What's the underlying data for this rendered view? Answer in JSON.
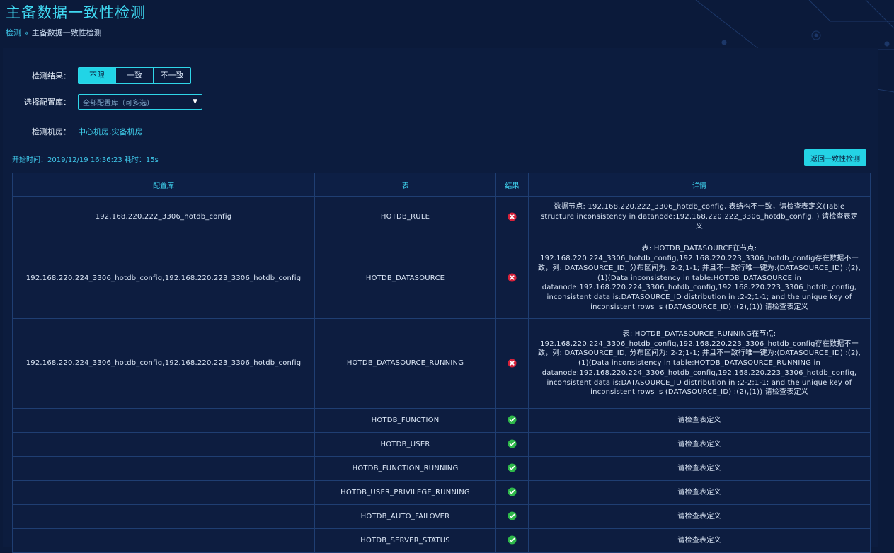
{
  "page": {
    "title": "主备数据一致性检测",
    "breadcrumb": {
      "parent": "检测",
      "separator": "»",
      "current": "主备数据一致性检测"
    }
  },
  "filters": {
    "result_label": "检测结果：",
    "result_options": [
      "不限",
      "一致",
      "不一致"
    ],
    "result_selected": "不限",
    "config_label": "选择配置库：",
    "config_placeholder": "全部配置库（可多选）",
    "room_label": "检测机房：",
    "room_value": "中心机房,灾备机房"
  },
  "run_info": "开始时间：2019/12/19 16:36:23 耗时：15s",
  "back_button": "返回一致性检测",
  "colors": {
    "accent": "#24d3e5",
    "background": "#0b1a3a",
    "ok": "#2eb84a",
    "error": "#d6213a"
  },
  "table": {
    "headers": [
      "配置库",
      "表",
      "结果",
      "详情"
    ],
    "rows": [
      {
        "config": "192.168.220.222_3306_hotdb_config",
        "table": "HOTDB_RULE",
        "result": "error",
        "detail": "数据节点: 192.168.220.222_3306_hotdb_config, 表结构不一致，请检查表定义(Table structure inconsistency in datanode:192.168.220.222_3306_hotdb_config, ) 请检查表定义"
      },
      {
        "config": "192.168.220.224_3306_hotdb_config,192.168.220.223_3306_hotdb_config",
        "table": "HOTDB_DATASOURCE",
        "result": "error",
        "detail": "表: HOTDB_DATASOURCE在节点: 192.168.220.224_3306_hotdb_config,192.168.220.223_3306_hotdb_config存在数据不一致，列: DATASOURCE_ID, 分布区间为: 2-2;1-1; 并且不一致行唯一键为:(DATASOURCE_ID) :(2),(1)(Data inconsistency in table:HOTDB_DATASOURCE in datanode:192.168.220.224_3306_hotdb_config,192.168.220.223_3306_hotdb_config, inconsistent data is:DATASOURCE_ID distribution in :2-2;1-1; and the unique key of inconsistent rows is (DATASOURCE_ID) :(2),(1)) 请检查表定义"
      },
      {
        "config": "192.168.220.224_3306_hotdb_config,192.168.220.223_3306_hotdb_config",
        "table": "HOTDB_DATASOURCE_RUNNING",
        "result": "error",
        "detail": "表: HOTDB_DATASOURCE_RUNNING在节点: 192.168.220.224_3306_hotdb_config,192.168.220.223_3306_hotdb_config存在数据不一致，列: DATASOURCE_ID, 分布区间为: 2-2;1-1; 并且不一致行唯一键为:(DATASOURCE_ID) :(2),(1)(Data inconsistency in table:HOTDB_DATASOURCE_RUNNING in datanode:192.168.220.224_3306_hotdb_config,192.168.220.223_3306_hotdb_config, inconsistent data is:DATASOURCE_ID distribution in :2-2;1-1; and the unique key of inconsistent rows is (DATASOURCE_ID) :(2),(1)) 请检查表定义"
      },
      {
        "config": "",
        "table": "HOTDB_FUNCTION",
        "result": "ok",
        "detail": "请检查表定义"
      },
      {
        "config": "",
        "table": "HOTDB_USER",
        "result": "ok",
        "detail": "请检查表定义"
      },
      {
        "config": "",
        "table": "HOTDB_FUNCTION_RUNNING",
        "result": "ok",
        "detail": "请检查表定义"
      },
      {
        "config": "",
        "table": "HOTDB_USER_PRIVILEGE_RUNNING",
        "result": "ok",
        "detail": "请检查表定义"
      },
      {
        "config": "",
        "table": "HOTDB_AUTO_FAILOVER",
        "result": "ok",
        "detail": "请检查表定义"
      },
      {
        "config": "",
        "table": "HOTDB_SERVER_STATUS",
        "result": "ok",
        "detail": "请检查表定义"
      }
    ]
  }
}
